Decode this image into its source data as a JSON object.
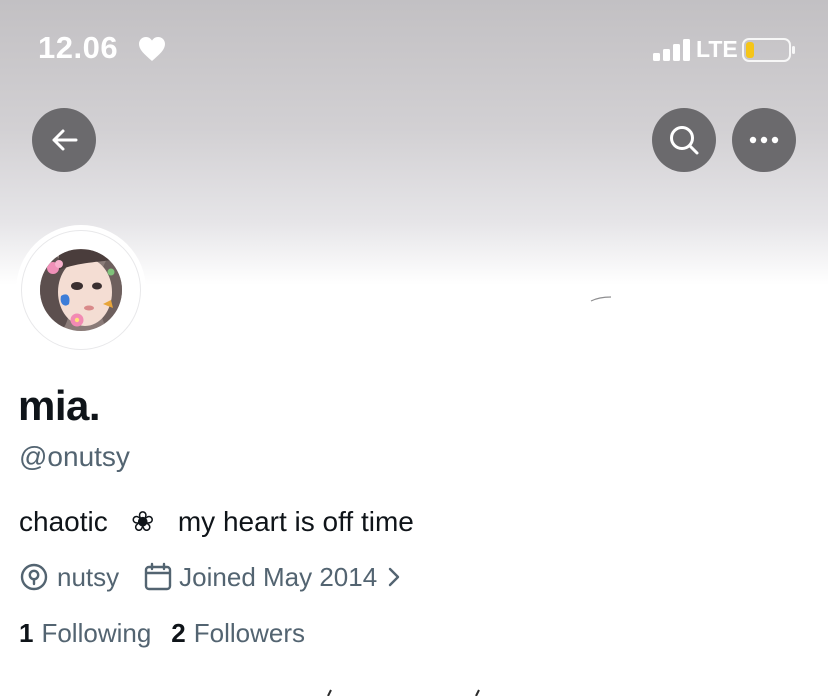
{
  "status_bar": {
    "time": "12.06",
    "network": "LTE",
    "icons": [
      "heart-icon",
      "signal-icon",
      "battery-icon"
    ],
    "battery_color": "#f5c518"
  },
  "nav": {
    "back_icon": "arrow-left-icon",
    "search_icon": "search-icon",
    "more_icon": "more-icon",
    "button_color": "#6b6a6d"
  },
  "profile": {
    "display_name": "mia.",
    "handle": "@onutsy",
    "bio": "chaotic   ❀   my heart is off time",
    "location": "nutsy",
    "joined": "Joined May 2014",
    "following_count": "1",
    "following_label": "Following",
    "followers_count": "2",
    "followers_label": "Followers"
  },
  "colors": {
    "text_primary": "#0f1419",
    "text_secondary": "#536471"
  }
}
